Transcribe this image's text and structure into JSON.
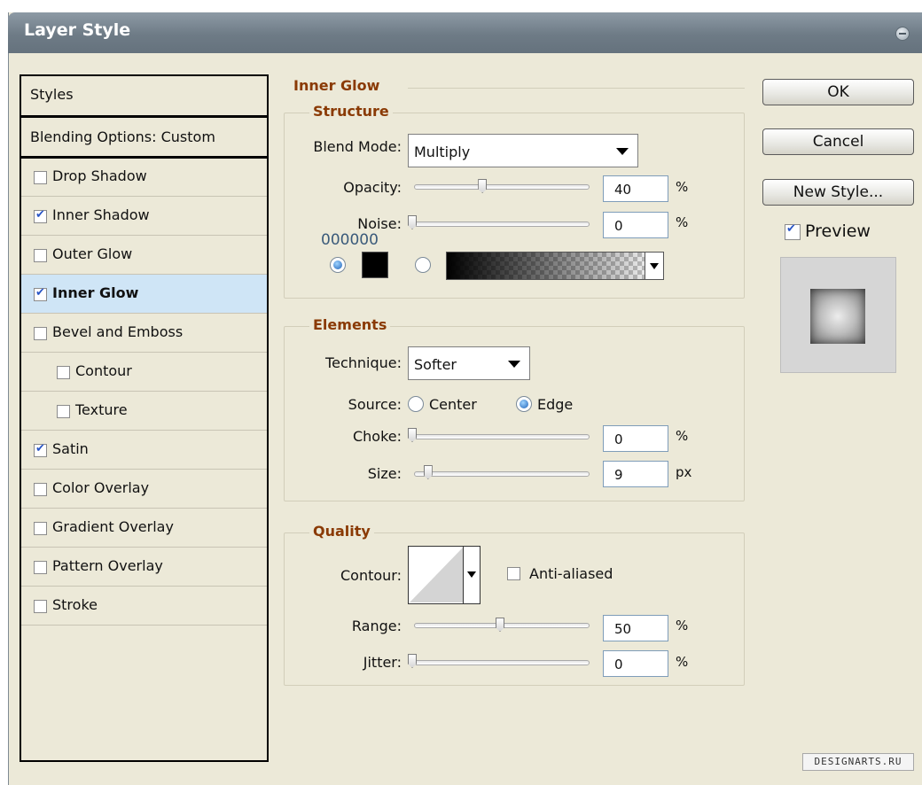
{
  "window": {
    "title": "Layer Style"
  },
  "styles_list": {
    "header": "Styles",
    "blending": "Blending Options: Custom",
    "items": [
      {
        "label": "Drop Shadow",
        "checked": false,
        "indent": false,
        "selected": false
      },
      {
        "label": "Inner Shadow",
        "checked": true,
        "indent": false,
        "selected": false
      },
      {
        "label": "Outer Glow",
        "checked": false,
        "indent": false,
        "selected": false
      },
      {
        "label": "Inner Glow",
        "checked": true,
        "indent": false,
        "selected": true
      },
      {
        "label": "Bevel and Emboss",
        "checked": false,
        "indent": false,
        "selected": false
      },
      {
        "label": "Contour",
        "checked": false,
        "indent": true,
        "selected": false
      },
      {
        "label": "Texture",
        "checked": false,
        "indent": true,
        "selected": false
      },
      {
        "label": "Satin",
        "checked": true,
        "indent": false,
        "selected": false
      },
      {
        "label": "Color Overlay",
        "checked": false,
        "indent": false,
        "selected": false
      },
      {
        "label": "Gradient Overlay",
        "checked": false,
        "indent": false,
        "selected": false
      },
      {
        "label": "Pattern Overlay",
        "checked": false,
        "indent": false,
        "selected": false
      },
      {
        "label": "Stroke",
        "checked": false,
        "indent": false,
        "selected": false
      }
    ]
  },
  "inner_glow": {
    "title": "Inner Glow",
    "structure": {
      "title": "Structure",
      "blend_mode_label": "Blend Mode:",
      "blend_mode_value": "Multiply",
      "opacity_label": "Opacity:",
      "opacity_value": "40",
      "opacity_unit": "%",
      "opacity_level": 0.4,
      "noise_label": "Noise:",
      "noise_value": "0",
      "noise_unit": "%",
      "noise_level": 0.0,
      "color_hex": "000000",
      "color_swatch": "#000000",
      "color_radio_selected": true,
      "gradient_radio_selected": false
    },
    "elements": {
      "title": "Elements",
      "technique_label": "Technique:",
      "technique_value": "Softer",
      "source_label": "Source:",
      "source_center": "Center",
      "source_edge": "Edge",
      "source_selected": "Edge",
      "choke_label": "Choke:",
      "choke_value": "0",
      "choke_unit": "%",
      "choke_level": 0.0,
      "size_label": "Size:",
      "size_value": "9",
      "size_unit": "px",
      "size_level": 0.09
    },
    "quality": {
      "title": "Quality",
      "contour_label": "Contour:",
      "anti_aliased_label": "Anti-aliased",
      "anti_aliased_checked": false,
      "range_label": "Range:",
      "range_value": "50",
      "range_unit": "%",
      "range_level": 0.5,
      "jitter_label": "Jitter:",
      "jitter_value": "0",
      "jitter_unit": "%",
      "jitter_level": 0.0
    }
  },
  "buttons": {
    "ok": "OK",
    "cancel": "Cancel",
    "new_style": "New Style..."
  },
  "preview": {
    "label": "Preview",
    "checked": true
  },
  "watermark": "DESIGNARTS.RU",
  "colors": {
    "accent_text": "#8a3a05",
    "selection": "#cfe5f6",
    "titlebar": "#6e7b86"
  }
}
